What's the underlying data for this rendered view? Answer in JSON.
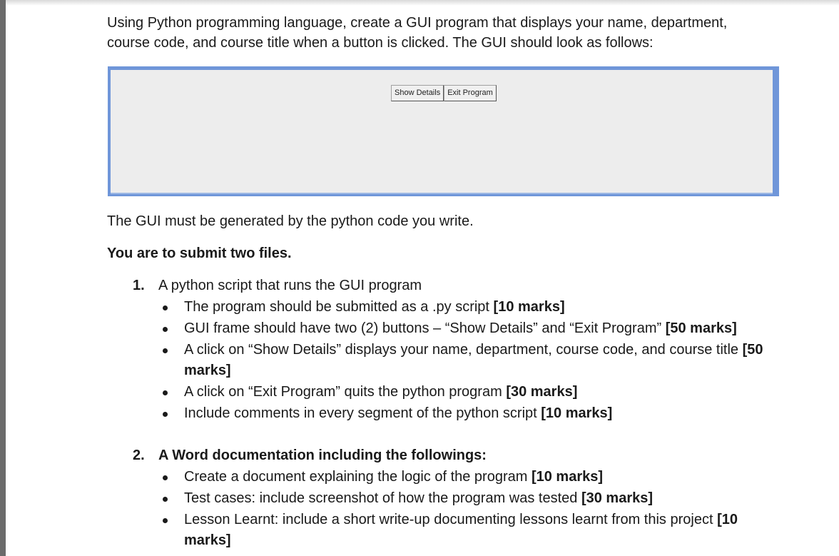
{
  "intro": {
    "line1": "Using Python programming language, create a GUI program that displays your name, department,",
    "line2": "course code, and course title when a button is clicked. The GUI should look as follows:"
  },
  "gui": {
    "show_button": "Show Details",
    "exit_button": "Exit Program"
  },
  "gui_note": "The GUI must be generated by the python code you write.",
  "submit_heading": "You are to submit two files.",
  "item1": {
    "number": "1.",
    "title": "A python script that runs the GUI program",
    "bullets": [
      {
        "text": "The program should be submitted as a .py script ",
        "marks": "[10 marks]"
      },
      {
        "text": "GUI frame should have two (2) buttons – “Show Details” and “Exit Program” ",
        "marks": "[50 marks]"
      },
      {
        "text": "A click on “Show Details” displays your name, department, course code, and course title ",
        "marks": "[50",
        "marks_cont": "marks]"
      },
      {
        "text": "A click on “Exit Program” quits the python program ",
        "marks": "[30 marks]"
      },
      {
        "text": "Include comments in every segment of the python script ",
        "marks": "[10 marks]"
      }
    ]
  },
  "item2": {
    "number": "2.",
    "title": "A Word documentation including the followings:",
    "bullets": [
      {
        "text": "Create a document explaining the logic of the program ",
        "marks": "[10 marks]"
      },
      {
        "text": "Test cases: include screenshot of how the program was tested ",
        "marks": "[30 marks]"
      },
      {
        "text": "Lesson Learnt: include a short write-up documenting lessons learnt from this project ",
        "marks": "[10",
        "marks_cont": "marks]"
      }
    ]
  }
}
